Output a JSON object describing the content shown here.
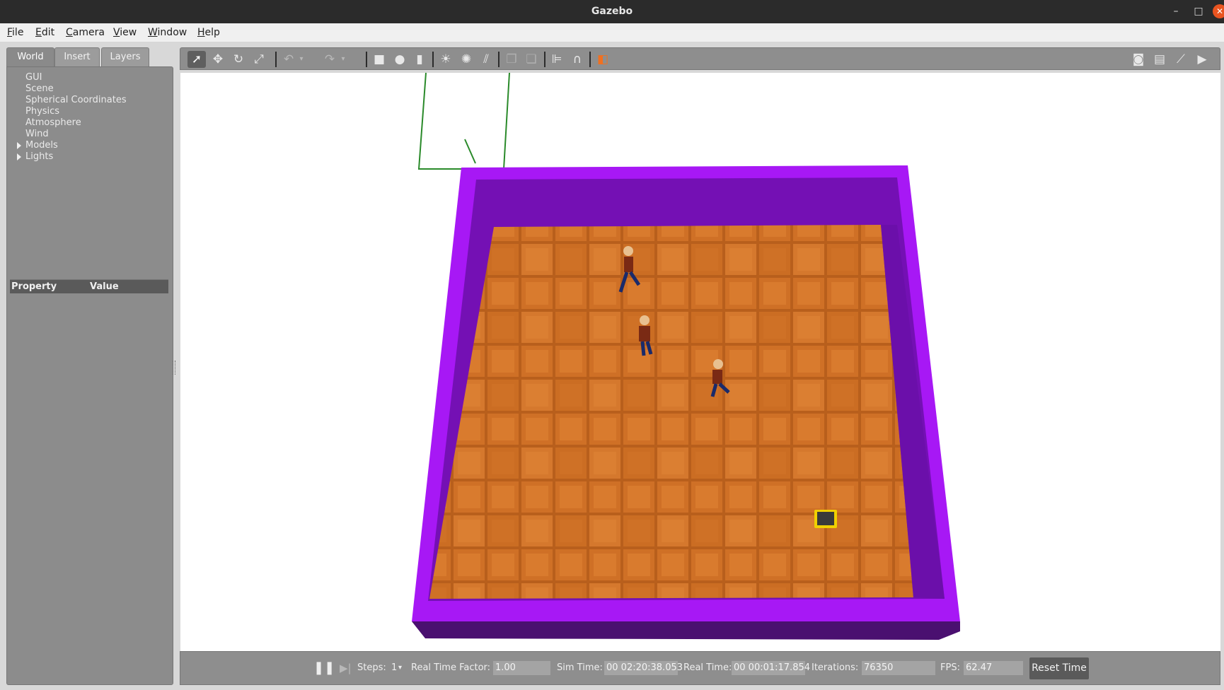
{
  "window": {
    "title": "Gazebo",
    "minimize_glyph": "–",
    "maximize_glyph": "□",
    "close_glyph": "✕"
  },
  "menu": [
    "File",
    "Edit",
    "Camera",
    "View",
    "Window",
    "Help"
  ],
  "left_panel": {
    "tabs": [
      "World",
      "Insert",
      "Layers"
    ],
    "active_tab": "World",
    "tree": [
      {
        "label": "GUI",
        "expandable": false
      },
      {
        "label": "Scene",
        "expandable": false
      },
      {
        "label": "Spherical Coordinates",
        "expandable": false
      },
      {
        "label": "Physics",
        "expandable": false
      },
      {
        "label": "Atmosphere",
        "expandable": false
      },
      {
        "label": "Wind",
        "expandable": false
      },
      {
        "label": "Models",
        "expandable": true
      },
      {
        "label": "Lights",
        "expandable": true
      }
    ],
    "property_header": {
      "property": "Property",
      "value": "Value"
    }
  },
  "toolbar": {
    "icons": [
      "select-arrow-icon",
      "translate-icon",
      "rotate-icon",
      "scale-icon",
      "undo-icon",
      "undo-dropdown-icon",
      "redo-icon",
      "redo-dropdown-icon",
      "box-shape-icon",
      "sphere-shape-icon",
      "cylinder-shape-icon",
      "point-light-icon",
      "spot-light-icon",
      "directional-light-icon",
      "copy-icon",
      "paste-icon",
      "align-icon",
      "snap-icon",
      "view-angle-icon",
      "screenshot-icon",
      "log-icon",
      "plot-icon",
      "video-record-icon"
    ]
  },
  "bottom_bar": {
    "steps_label": "Steps:",
    "steps_value": "1",
    "rtf_label": "Real Time Factor:",
    "rtf_value": "1.00",
    "sim_time_label": "Sim Time:",
    "sim_time_value": "00 02:20:38.053",
    "real_time_label": "Real Time:",
    "real_time_value": "00 00:01:17.854",
    "iterations_label": "Iterations:",
    "iterations_value": "76350",
    "fps_label": "FPS:",
    "fps_value": "62.47",
    "reset_label": "Reset Time"
  },
  "scene": {
    "wall_color": "#a010f0",
    "inner_wall_color": "#7010b0",
    "floor_color": "#c8691e",
    "background": "#ffffff"
  }
}
